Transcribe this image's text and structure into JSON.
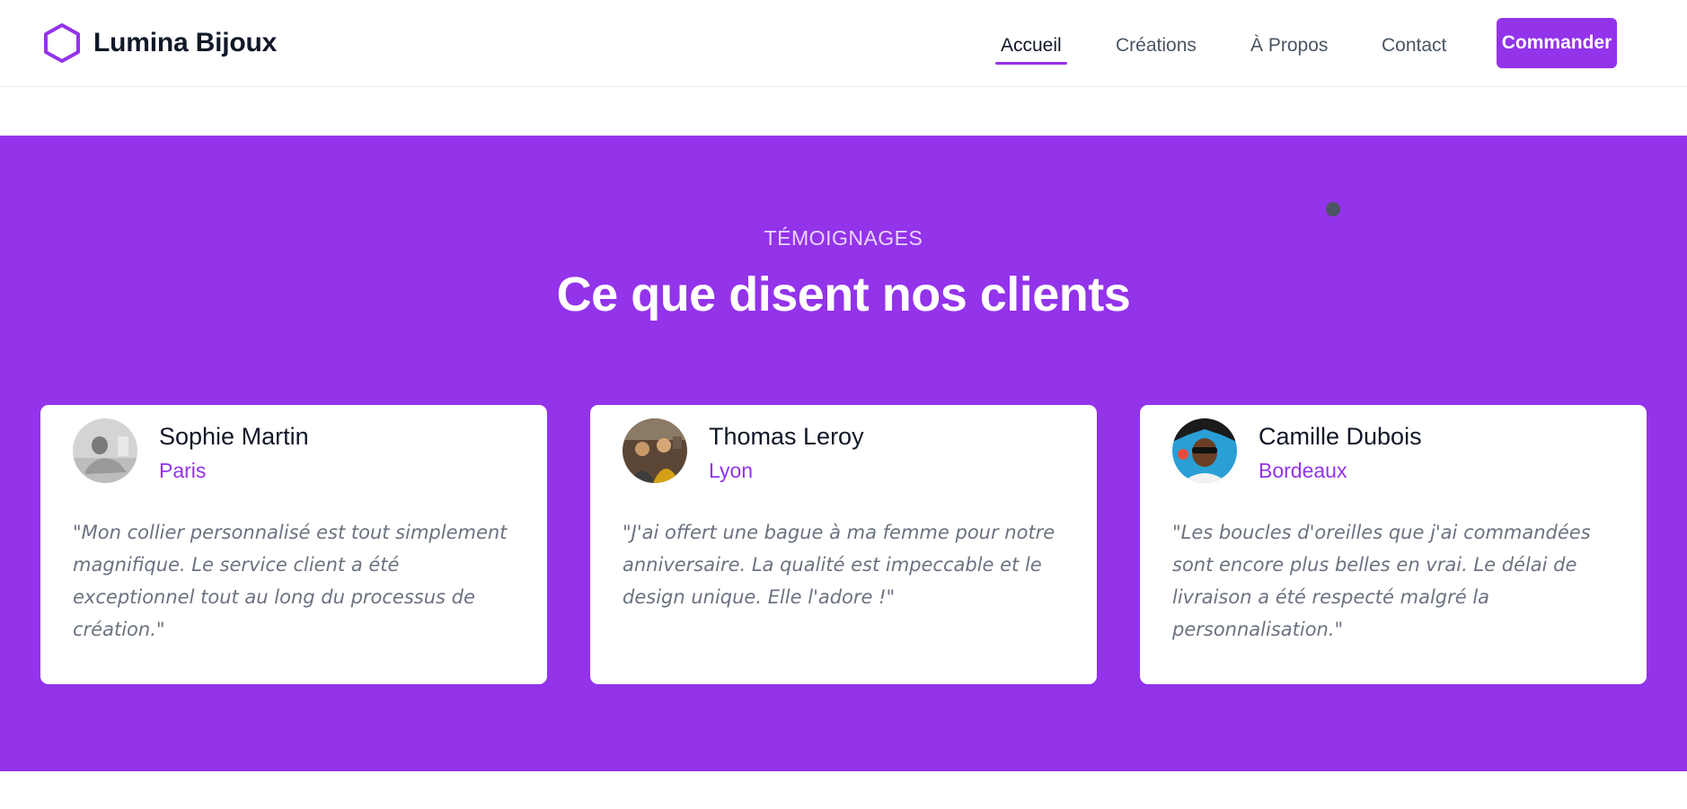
{
  "brand": {
    "name": "Lumina Bijoux",
    "logo_icon": "hexagon-icon",
    "accent": "#9333ea"
  },
  "nav": {
    "links": [
      {
        "label": "Accueil",
        "active": true
      },
      {
        "label": "Créations",
        "active": false
      },
      {
        "label": "À Propos",
        "active": false
      },
      {
        "label": "Contact",
        "active": false
      }
    ],
    "cta_label": "Commander"
  },
  "testimonials": {
    "eyebrow": "TÉMOIGNAGES",
    "title": "Ce que disent nos clients",
    "background": "#9333ea",
    "items": [
      {
        "name": "Sophie Martin",
        "city": "Paris",
        "quote": "\"Mon collier personnalisé est tout simplement magnifique. Le service client a été exceptionnel tout au long du processus de création.\"",
        "avatar": "avatar-photo"
      },
      {
        "name": "Thomas Leroy",
        "city": "Lyon",
        "quote": "\"J'ai offert une bague à ma femme pour notre anniversaire. La qualité est impeccable et le design unique. Elle l'adore !\"",
        "avatar": "avatar-photo"
      },
      {
        "name": "Camille Dubois",
        "city": "Bordeaux",
        "quote": "\"Les boucles d'oreilles que j'ai commandées sont encore plus belles en vrai. Le délai de livraison a été respecté malgré la personnalisation.\"",
        "avatar": "avatar-photo"
      }
    ]
  }
}
